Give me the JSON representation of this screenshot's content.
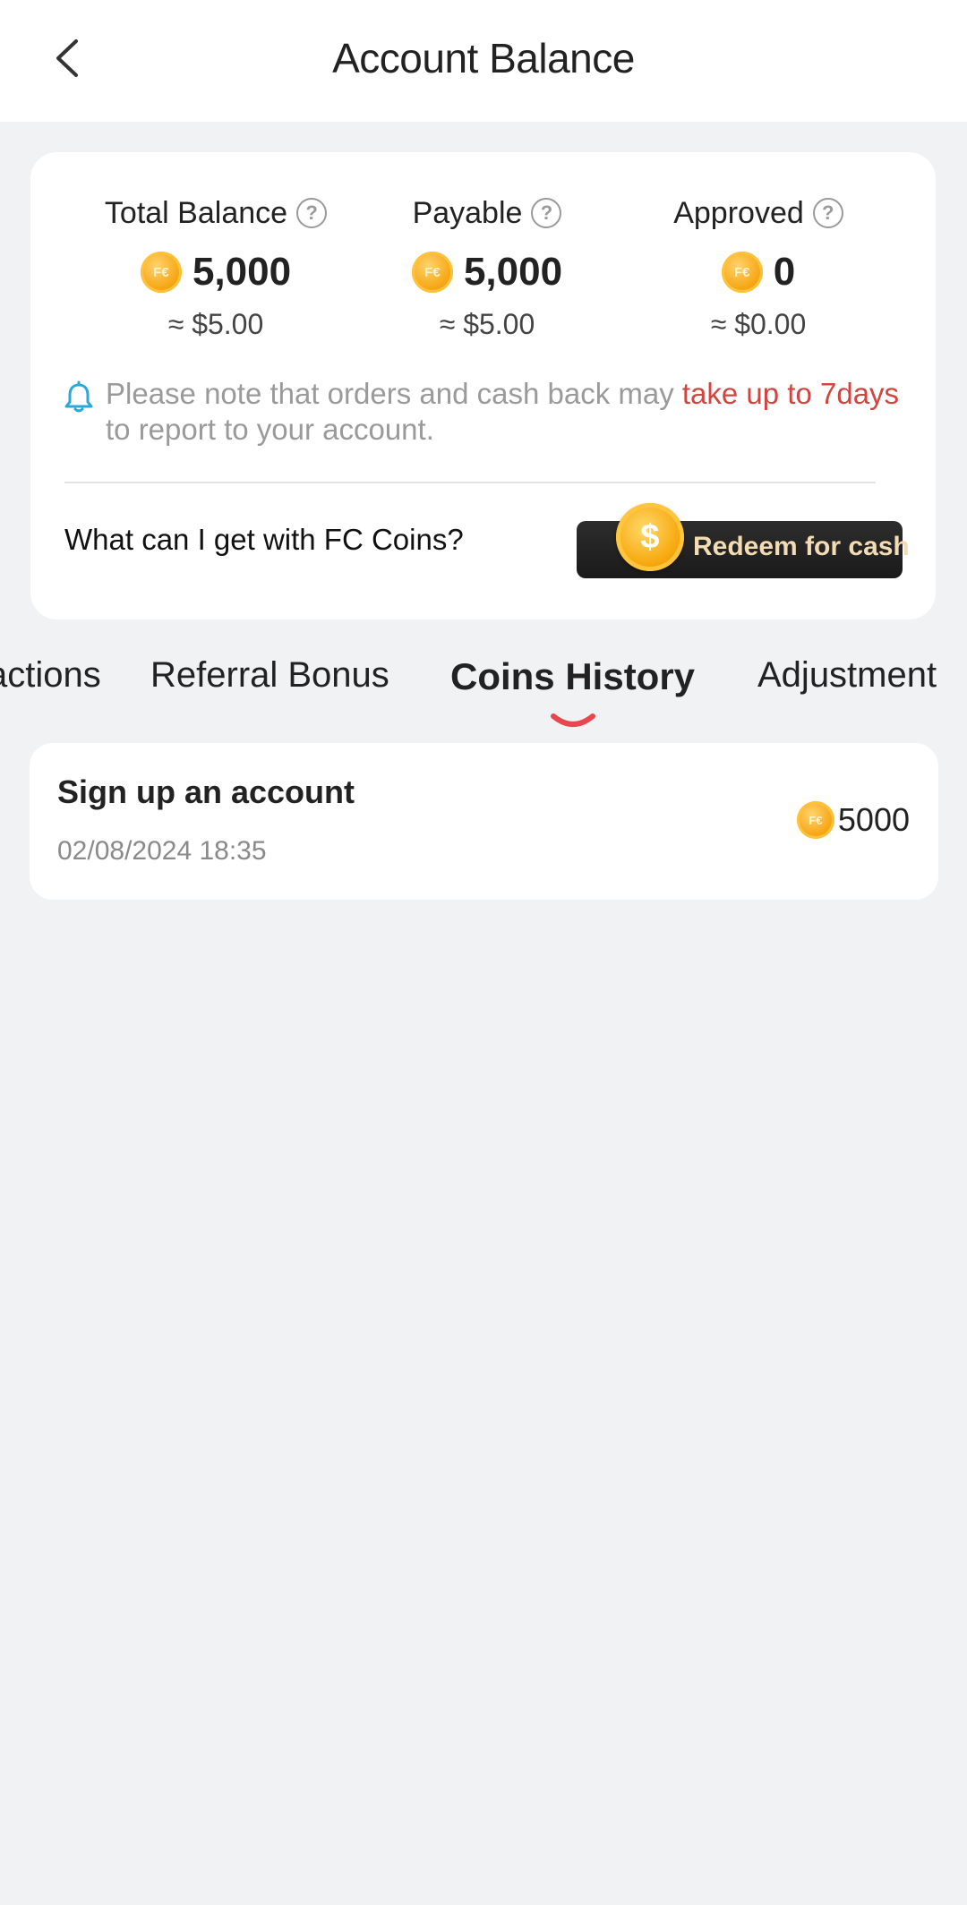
{
  "header": {
    "title": "Account Balance",
    "back_icon": "chevron-left-icon"
  },
  "balance": {
    "total": {
      "label": "Total Balance",
      "coins": "5,000",
      "usd": "≈ $5.00"
    },
    "payable": {
      "label": "Payable",
      "coins": "5,000",
      "usd": "≈ $5.00"
    },
    "approved": {
      "label": "Approved",
      "coins": "0",
      "usd": "≈ $0.00"
    },
    "help_icon": "question-circle-icon",
    "coin_glyph": "F€"
  },
  "notice": {
    "text_before": "Please note that orders and cash back may ",
    "highlight": "take up to 7days",
    "text_after": " to report to your account.",
    "highlight_color": "#d0453f",
    "icon": "bell-icon"
  },
  "fc": {
    "question": "What can I get with FC Coins?",
    "redeem_label": "Redeem for cash",
    "redeem_coin_glyph": "$"
  },
  "tabs": [
    {
      "label": "Transactions",
      "visible_text": "actions"
    },
    {
      "label": "Referral Bonus"
    },
    {
      "label": "Coins History",
      "active": true
    },
    {
      "label": "Adjustment"
    }
  ],
  "records": [
    {
      "title": "Sign up an account",
      "date": "02/08/2024 18:35",
      "amount": "5000"
    }
  ],
  "colors": {
    "accent": "#e8474e",
    "background": "#f1f2f4",
    "coin": "#f6a412"
  }
}
